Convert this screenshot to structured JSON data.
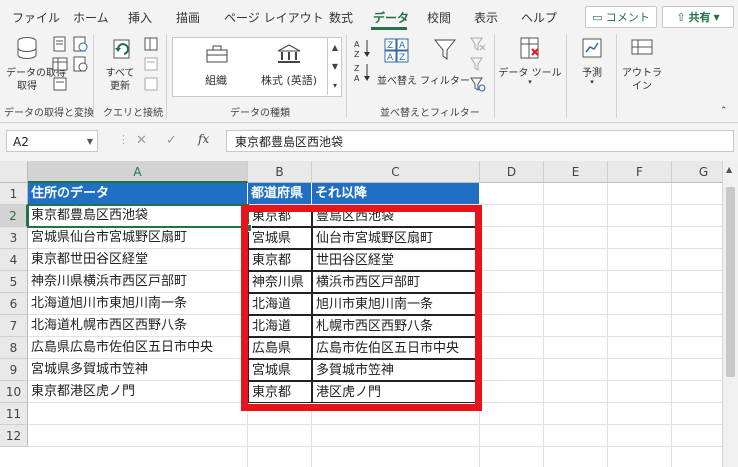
{
  "menu": {
    "tabs": [
      "ファイル",
      "ホーム",
      "挿入",
      "描画",
      "ページ レイアウト",
      "数式",
      "データ",
      "校閲",
      "表示",
      "ヘルプ"
    ],
    "active_tab": "データ",
    "comment_label": "コメント",
    "share_label": "共有"
  },
  "ribbon": {
    "get_data_label": "データの取得",
    "get_data_dropdown": "取得",
    "refresh_label": "すべて",
    "refresh_label2": "更新",
    "gallery_item1": "組織",
    "gallery_item2": "株式 (英語)",
    "sort_label": "並べ替え",
    "filter_label": "フィルター",
    "data_tools_label": "データ ツール",
    "forecast_label": "予測",
    "outline_label": "アウトラ",
    "outline_label2": "イン",
    "groups": {
      "get_transform": "データの取得と変換",
      "queries": "クエリと接続",
      "data_types": "データの種類",
      "sort_filter": "並べ替えとフィルター"
    }
  },
  "formula_bar": {
    "name_box": "A2",
    "cancel": "✕",
    "enter": "✓",
    "fx": "fx",
    "content": "東京都豊島区西池袋"
  },
  "sheet": {
    "columns": [
      "A",
      "B",
      "C",
      "D",
      "E",
      "F",
      "G"
    ],
    "rows": [
      "1",
      "2",
      "3",
      "4",
      "5",
      "6",
      "7",
      "8",
      "9",
      "10",
      "11",
      "12"
    ],
    "header": [
      "住所のデータ",
      "都道府県",
      "それ以降"
    ],
    "data": [
      [
        "東京都豊島区西池袋",
        "東京都",
        "豊島区西池袋"
      ],
      [
        "宮城県仙台市宮城野区扇町",
        "宮城県",
        "仙台市宮城野区扇町"
      ],
      [
        "東京都世田谷区経堂",
        "東京都",
        "世田谷区経堂"
      ],
      [
        "神奈川県横浜市西区戸部町",
        "神奈川県",
        "横浜市西区戸部町"
      ],
      [
        "北海道旭川市東旭川南一条",
        "北海道",
        "旭川市東旭川南一条"
      ],
      [
        "北海道札幌市西区西野八条",
        "北海道",
        "札幌市西区西野八条"
      ],
      [
        "広島県広島市佐伯区五日市中央",
        "広島県",
        "広島市佐伯区五日市中央"
      ],
      [
        "宮城県多賀城市笠神",
        "宮城県",
        "多賀城市笠神"
      ],
      [
        "東京都港区虎ノ門",
        "東京都",
        "港区虎ノ門"
      ]
    ]
  },
  "colors": {
    "accent": "#217346",
    "header_fill": "#1f6fc5",
    "highlight_box": "#e8141c"
  }
}
